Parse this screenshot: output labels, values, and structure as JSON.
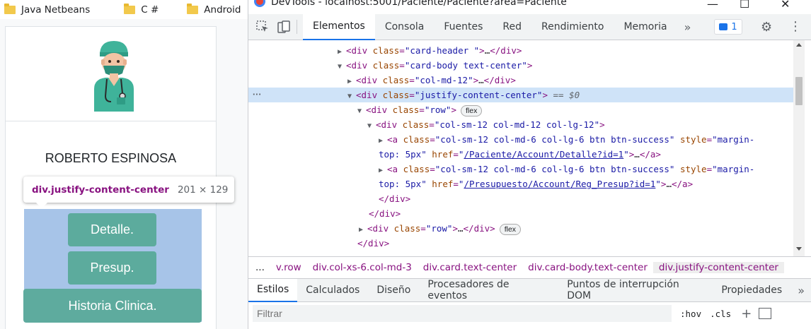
{
  "bookmarks": [
    "Java Netbeans",
    "C #",
    "Android",
    ""
  ],
  "page": {
    "name": "ROBERTO ESPINOSA",
    "buttons": {
      "detalle": "Detalle.",
      "presup": "Presup.",
      "historia": "Historia Clinica."
    },
    "tooltip": {
      "selector": "div.justify-content-center",
      "size": "201 × 129"
    }
  },
  "devtools": {
    "title": "DevTools - localhost:5001/Paciente/Paciente?area=Paciente",
    "tabs": [
      "Elementos",
      "Consola",
      "Fuentes",
      "Red",
      "Rendimiento",
      "Memoria"
    ],
    "more_tabs": "»",
    "issues_count": "1",
    "dom": {
      "l1_tag": "div",
      "l1_attr": "class",
      "l1_val": "\"card-header \"",
      "l2_tag": "div",
      "l2_attr": "class",
      "l2_val": "\"card-body text-center\"",
      "l3_tag": "div",
      "l3_attr": "class",
      "l3_val": "\"col-md-12\"",
      "l4_tag": "div",
      "l4_attr": "class",
      "l4_val": "\"justify-content-center\"",
      "l4_eq": "== $0",
      "l5_tag": "div",
      "l5_attr": "class",
      "l5_val": "\"row\"",
      "flex": "flex",
      "l6_tag": "div",
      "l6_attr": "class",
      "l6_val": "\"col-sm-12 col-md-12 col-lg-12\"",
      "l7_tag": "a",
      "l7_attr": "class",
      "l7_val": "\"col-sm-12 col-md-6 col-lg-6 btn btn-success\"",
      "l7_style": "style",
      "l7_style_val": "\"margin-",
      "l7b_val": "top: 5px\"",
      "l7b_href": "href",
      "l7b_link": "/Paciente/Account/Detalle?id=1",
      "l8_tag": "a",
      "l8_attr": "class",
      "l8_val": "\"col-sm-12 col-md-6 col-lg-6 btn btn-success\"",
      "l8_style": "style",
      "l8_style_val": "\"margin-",
      "l8b_val": "top: 5px\"",
      "l8b_href": "href",
      "l8b_link": "/Presupuesto/Account/Reg_Presup?id=1",
      "close_div": "</div>",
      "l11_tag": "div",
      "l11_attr": "class",
      "l11_val": "\"row\"",
      "ellipsis": "…"
    },
    "breadcrumbs": [
      "...",
      "v.row",
      "div.col-xs-6.col-md-3",
      "div.card.text-center",
      "div.card-body.text-center",
      "div.justify-content-center"
    ],
    "subtabs": [
      "Estilos",
      "Calculados",
      "Diseño",
      "Procesadores de eventos",
      "Puntos de interrupción DOM",
      "Propiedades"
    ],
    "more_subtabs": "»",
    "filter_placeholder": "Filtrar",
    "filter_hov": ":hov",
    "filter_cls": ".cls",
    "filter_plus": "+"
  },
  "colors": {
    "button": "#5cab9d",
    "highlight": "#a7c4e8",
    "selected_row": "#cfe3f8",
    "accent": "#1a73e8"
  }
}
